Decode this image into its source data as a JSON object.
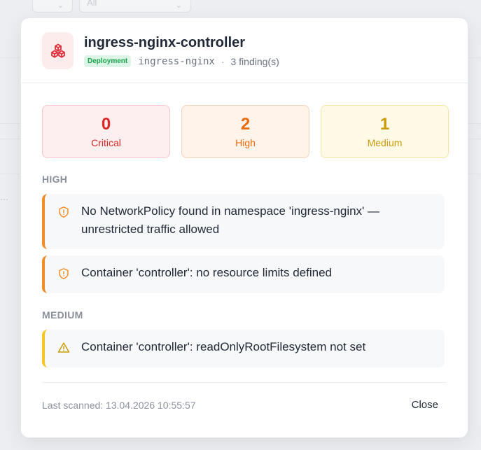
{
  "background": {
    "filter_select_value": "All"
  },
  "workload": {
    "name": "ingress-nginx-controller",
    "kind": "Deployment",
    "namespace": "ingress-nginx",
    "separator": "·",
    "findings_count": "3 finding(s)",
    "icon": "cubes-icon"
  },
  "summary": [
    {
      "count": "0",
      "label": "Critical",
      "color": "#dc2626"
    },
    {
      "count": "2",
      "label": "High",
      "color": "#ea6a0c"
    },
    {
      "count": "1",
      "label": "Medium",
      "color": "#c99a06"
    }
  ],
  "sections": {
    "high": {
      "label": "HIGH",
      "findings": [
        {
          "text": "No NetworkPolicy found in namespace 'ingress-nginx' — unrestricted traffic allowed",
          "icon": "shield-alert-icon"
        },
        {
          "text": "Container 'controller': no resource limits defined",
          "icon": "shield-alert-icon"
        }
      ]
    },
    "medium": {
      "label": "MEDIUM",
      "findings": [
        {
          "text": "Container 'controller': readOnlyRootFilesystem not set",
          "icon": "warning-triangle-icon"
        }
      ]
    }
  },
  "footer": {
    "last_scanned": "Last scanned: 13.04.2026 10:55:57",
    "close_label": "Close"
  },
  "colors": {
    "high_accent": "#f28c24",
    "medium_accent": "#f3c623",
    "brand_red": "#e0303a"
  }
}
